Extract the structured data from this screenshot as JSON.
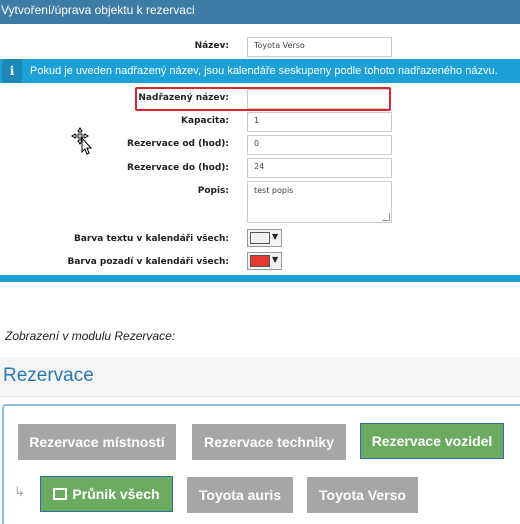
{
  "form": {
    "title": "Vytvoření/úprava objektu k rezervaci",
    "fields": {
      "name_label": "Název:",
      "name_value": "Toyota Verso",
      "parent_label": "Nadřazený název:",
      "parent_value": "",
      "capacity_label": "Kapacita:",
      "capacity_value": "1",
      "from_label": "Rezervace od (hod):",
      "from_value": "0",
      "to_label": "Rezervace do (hod):",
      "to_value": "24",
      "desc_label": "Popis:",
      "desc_value": "test popis",
      "text_color_label": "Barva textu v kalendáři všech:",
      "bg_color_label": "Barva pozadí v kalendáři všech:"
    },
    "info_icon": "i",
    "info_text": "Pokud je uveden nadřazený název, jsou kalendáře seskupeny podle tohoto nadřazeného názvu.",
    "text_color_swatch": "#f0f0f0",
    "bg_color_swatch": "#e63a2e",
    "caret_glyph": "▼"
  },
  "caption": "Zobrazení v modulu Rezervace:",
  "module": {
    "title": "Rezervace",
    "row1": [
      "Rezervace místností",
      "Rezervace techniky",
      "Rezervace vozidel"
    ],
    "row2": [
      "Průnik všech",
      "Toyota auris",
      "Toyota Verso"
    ],
    "arrow_glyph": "↳",
    "colors": {
      "accent": "#2a79b5",
      "active_green": "#6aab5f",
      "inactive_gray": "#a6a6a6",
      "info_blue": "#1ba1d7",
      "highlight_red": "#d9242f"
    }
  }
}
